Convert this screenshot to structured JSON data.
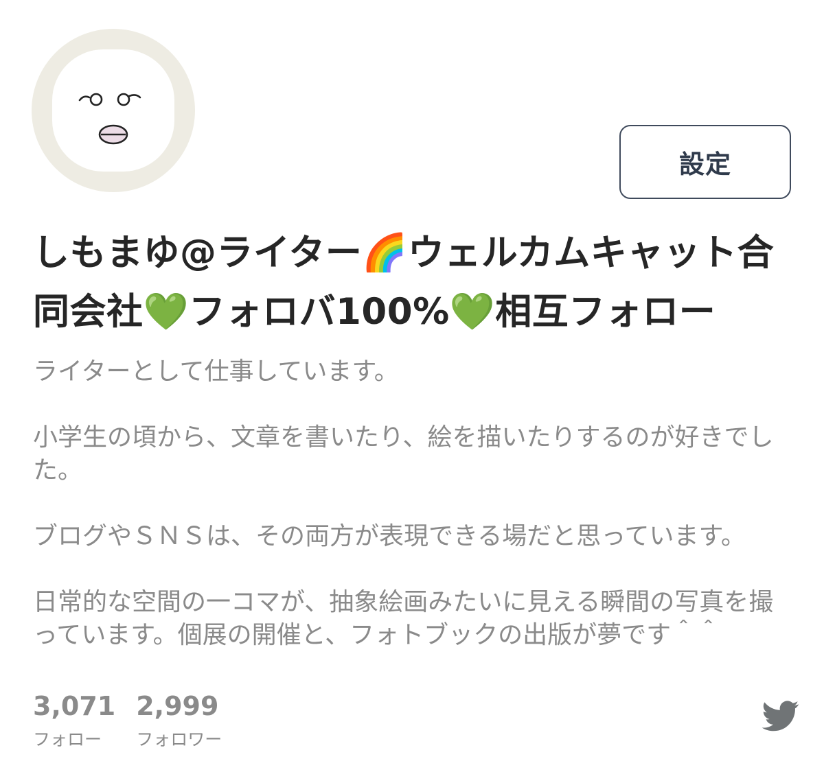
{
  "profile": {
    "display_name": "しもまゆ@ライター🌈ウェルカムキャット合同会社💚フォロバ100%💚相互フォロー",
    "avatar_icon": "face-illustration-avatar"
  },
  "actions": {
    "settings_label": "設定"
  },
  "bio": {
    "paragraphs": [
      "ライターとして仕事しています。",
      "小学生の頃から、文章を書いたり、絵を描いたりするのが好きでした。",
      "ブログやＳＮＳは、その両方が表現できる場だと思っています。",
      "日常的な空間の一コマが、抽象絵画みたいに見える瞬間の写真を撮っています。個展の開催と、フォトブックの出版が夢です＾＾"
    ]
  },
  "stats": {
    "following_count": "3,071",
    "following_label": "フォロー",
    "followers_count": "2,999",
    "followers_label": "フォロワー"
  },
  "brand": {
    "icon": "twitter-bird-icon",
    "color": "#707476"
  },
  "colors": {
    "name_text": "#262626",
    "bio_text": "#8a8a8a",
    "button_border": "#3f4a5c",
    "avatar_ring": "#eeece3"
  }
}
